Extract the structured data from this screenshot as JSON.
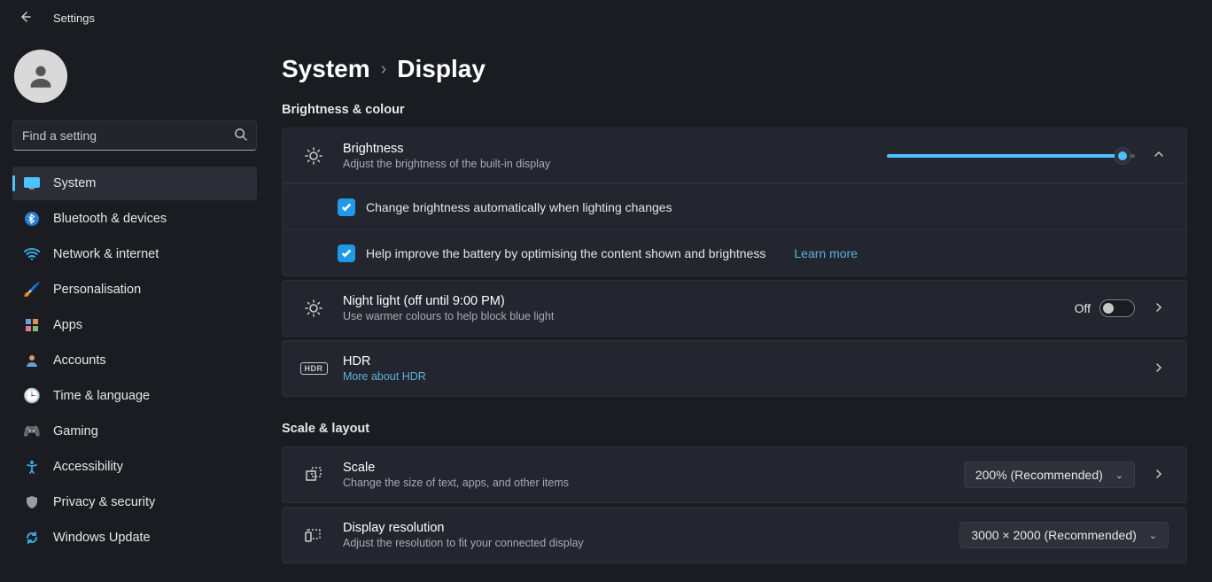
{
  "app": {
    "title": "Settings"
  },
  "search": {
    "placeholder": "Find a setting"
  },
  "sidebar": {
    "items": [
      {
        "label": "System"
      },
      {
        "label": "Bluetooth & devices"
      },
      {
        "label": "Network & internet"
      },
      {
        "label": "Personalisation"
      },
      {
        "label": "Apps"
      },
      {
        "label": "Accounts"
      },
      {
        "label": "Time & language"
      },
      {
        "label": "Gaming"
      },
      {
        "label": "Accessibility"
      },
      {
        "label": "Privacy & security"
      },
      {
        "label": "Windows Update"
      }
    ]
  },
  "breadcrumb": {
    "parent": "System",
    "current": "Display"
  },
  "sections": {
    "brightness_colour": {
      "title": "Brightness & colour",
      "brightness": {
        "title": "Brightness",
        "sub": "Adjust the brightness of the built-in display",
        "value_pct": 95,
        "opt_auto": "Change brightness automatically when lighting changes",
        "opt_battery": "Help improve the battery by optimising the content shown and brightness",
        "learn_more": "Learn more"
      },
      "night_light": {
        "title": "Night light (off until 9:00 PM)",
        "sub": "Use warmer colours to help block blue light",
        "state_label": "Off"
      },
      "hdr": {
        "title": "HDR",
        "link": "More about HDR",
        "badge": "HDR"
      }
    },
    "scale_layout": {
      "title": "Scale & layout",
      "scale": {
        "title": "Scale",
        "sub": "Change the size of text, apps, and other items",
        "value": "200% (Recommended)"
      },
      "resolution": {
        "title": "Display resolution",
        "sub": "Adjust the resolution to fit your connected display",
        "value": "3000 × 2000 (Recommended)"
      }
    }
  }
}
